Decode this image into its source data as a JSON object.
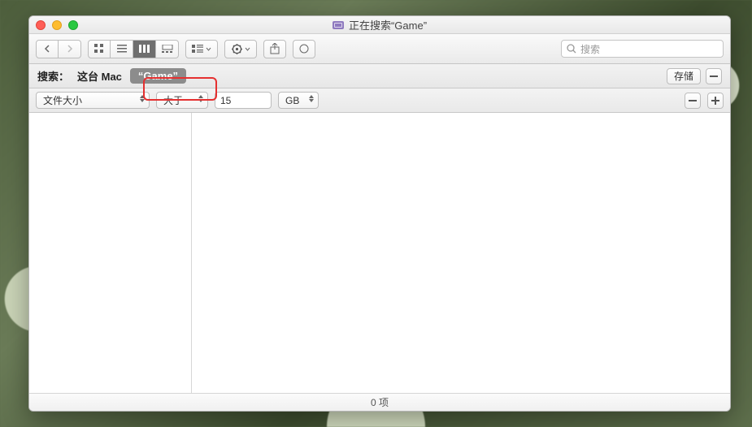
{
  "window": {
    "title": "正在搜索“Game”"
  },
  "search": {
    "placeholder": "搜索"
  },
  "scope": {
    "label": "搜索：",
    "this_mac": "这台 Mac",
    "token": "“Game”",
    "save": "存储"
  },
  "criteria": {
    "attr": "文件大小",
    "op": "大于",
    "value": "15",
    "unit": "GB"
  },
  "status": {
    "items": "0 项"
  }
}
